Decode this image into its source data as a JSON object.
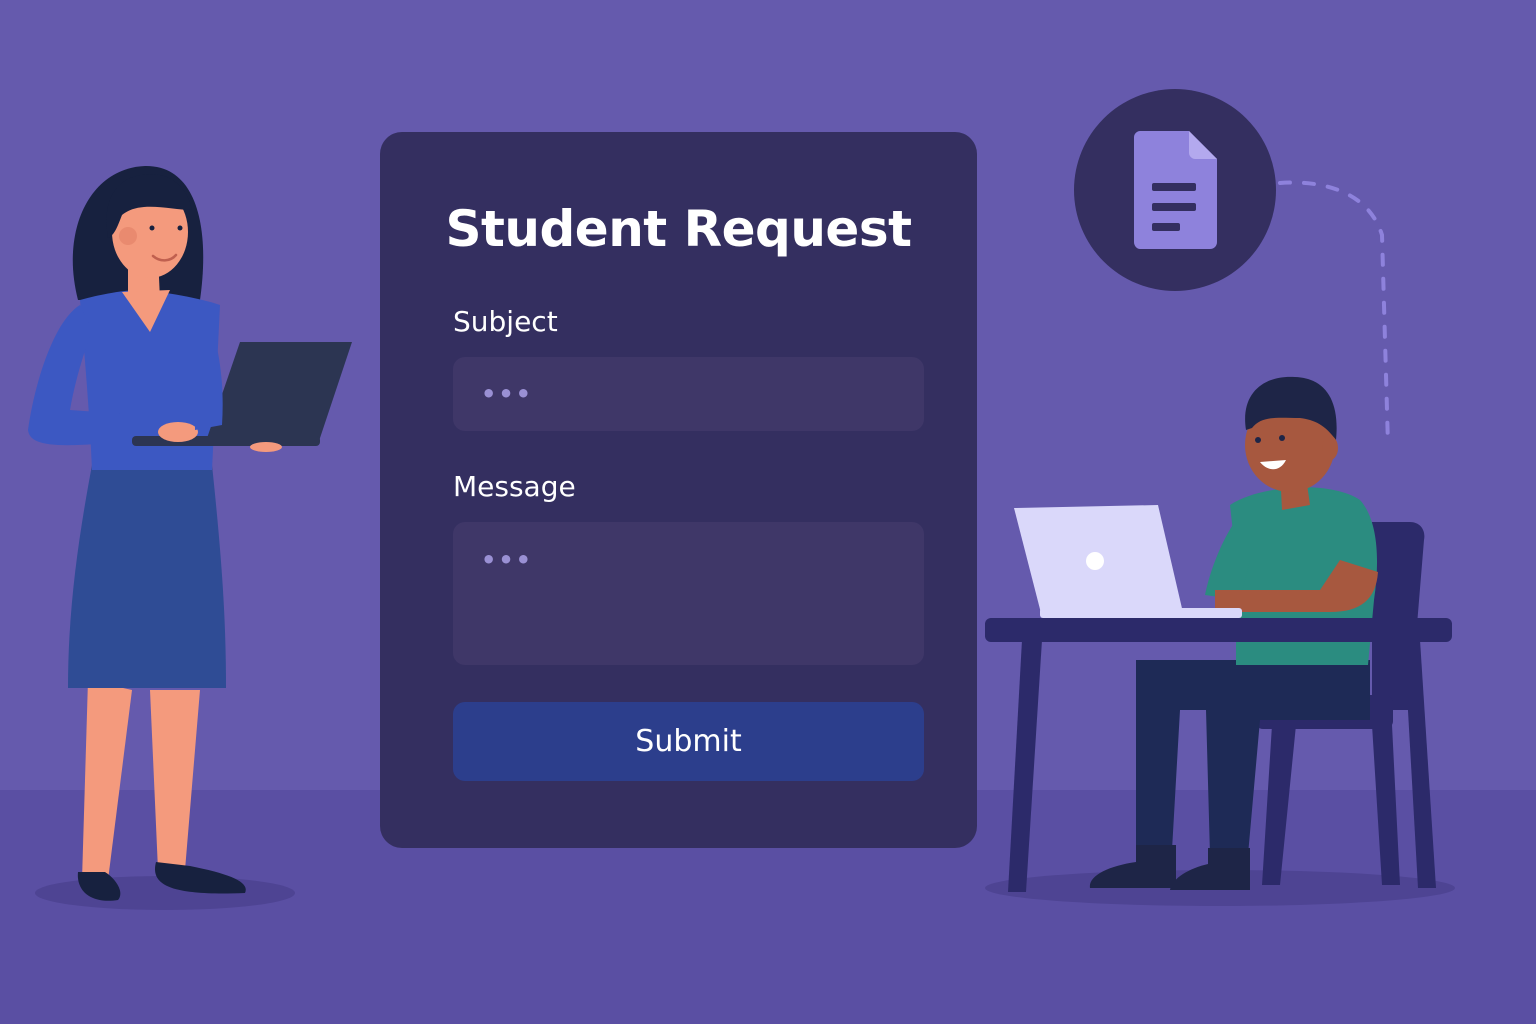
{
  "form": {
    "title": "Student Request",
    "subject_label": "Subject",
    "subject_placeholder": "•••",
    "message_label": "Message",
    "message_placeholder": "•••",
    "submit_label": "Submit"
  },
  "icons": {
    "document": "document-icon"
  },
  "colors": {
    "background": "#655aad",
    "card": "#342f60",
    "input": "#3f3768",
    "button": "#2c3e8c",
    "accent": "#8e82dc"
  }
}
